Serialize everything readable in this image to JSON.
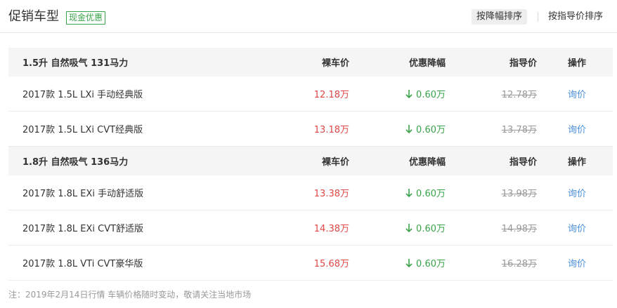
{
  "header": {
    "title": "促销车型",
    "badge": "现金优惠",
    "sort_active": "按降幅排序",
    "sort_other": "按指导价排序"
  },
  "groups": [
    {
      "heading": {
        "name": "1.5升 自然吸气 131马力",
        "price": "裸车价",
        "discount": "优惠降幅",
        "guide": "指导价",
        "operation": "操作"
      },
      "rows": [
        {
          "name": "2017款 1.5L LXi 手动经典版",
          "price": "12.18万",
          "discount": "0.60万",
          "guide": "12.78万",
          "action": "询价"
        },
        {
          "name": "2017款 1.5L LXi CVT经典版",
          "price": "13.18万",
          "discount": "0.60万",
          "guide": "13.78万",
          "action": "询价"
        }
      ]
    },
    {
      "heading": {
        "name": "1.8升 自然吸气 136马力",
        "price": "裸车价",
        "discount": "优惠降幅",
        "guide": "指导价",
        "operation": "操作"
      },
      "rows": [
        {
          "name": "2017款 1.8L EXi 手动舒适版",
          "price": "13.38万",
          "discount": "0.60万",
          "guide": "13.98万",
          "action": "询价"
        },
        {
          "name": "2017款 1.8L EXi CVT舒适版",
          "price": "14.38万",
          "discount": "0.60万",
          "guide": "14.98万",
          "action": "询价"
        },
        {
          "name": "2017款 1.8L VTi CVT豪华版",
          "price": "15.68万",
          "discount": "0.60万",
          "guide": "16.28万",
          "action": "询价"
        }
      ]
    }
  ],
  "note": "注：2019年2月14日行情 车辆价格随时变动，敬请关注当地市场",
  "colors": {
    "price": "#e04646",
    "discount": "#3aa34a",
    "link": "#4a90d9",
    "badge": "#3aa34a"
  },
  "icons": {
    "discount_arrow": "arrow-down-icon"
  }
}
